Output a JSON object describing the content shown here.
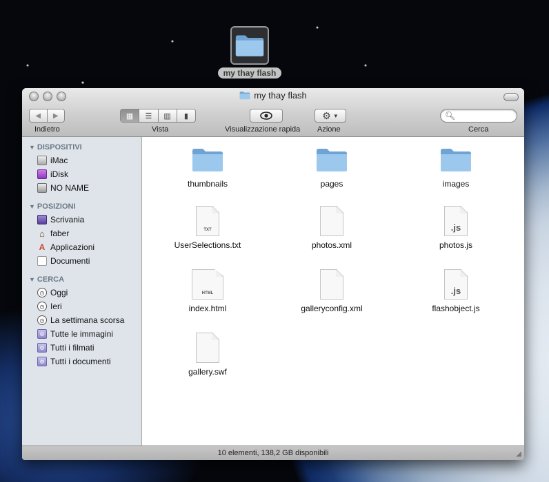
{
  "desktop": {
    "icon_label": "my thay flash"
  },
  "window": {
    "title": "my thay flash",
    "toolbar": {
      "back_label": "Indietro",
      "view_label": "Vista",
      "quicklook_label": "Visualizzazione rapida",
      "action_label": "Azione",
      "search_label": "Cerca",
      "search_placeholder": ""
    },
    "sidebar": {
      "sections": [
        {
          "title": "DISPOSITIVI",
          "items": [
            {
              "label": "iMac",
              "icon": "imac-icon"
            },
            {
              "label": "iDisk",
              "icon": "idisk-icon"
            },
            {
              "label": "NO NAME",
              "icon": "drive-icon"
            }
          ]
        },
        {
          "title": "POSIZIONI",
          "items": [
            {
              "label": "Scrivania",
              "icon": "desktop-icon"
            },
            {
              "label": "faber",
              "icon": "home-icon"
            },
            {
              "label": "Applicazioni",
              "icon": "applications-icon"
            },
            {
              "label": "Documenti",
              "icon": "documents-icon"
            }
          ]
        },
        {
          "title": "CERCA",
          "items": [
            {
              "label": "Oggi",
              "icon": "clock-icon"
            },
            {
              "label": "Ieri",
              "icon": "clock-icon"
            },
            {
              "label": "La settimana scorsa",
              "icon": "clock-icon"
            },
            {
              "label": "Tutte le immagini",
              "icon": "smart-folder-icon"
            },
            {
              "label": "Tutti i filmati",
              "icon": "smart-folder-icon"
            },
            {
              "label": "Tutti i documenti",
              "icon": "smart-folder-icon"
            }
          ]
        }
      ]
    },
    "files": [
      {
        "name": "thumbnails",
        "type": "folder"
      },
      {
        "name": "pages",
        "type": "folder"
      },
      {
        "name": "images",
        "type": "folder"
      },
      {
        "name": "UserSelections.txt",
        "type": "document",
        "tag": "TXT"
      },
      {
        "name": "photos.xml",
        "type": "document",
        "tag": ""
      },
      {
        "name": "photos.js",
        "type": "document",
        "tag": ".js"
      },
      {
        "name": "index.html",
        "type": "document",
        "tag": "HTML"
      },
      {
        "name": "galleryconfig.xml",
        "type": "document",
        "tag": ""
      },
      {
        "name": "flashobject.js",
        "type": "document",
        "tag": ".js"
      },
      {
        "name": "gallery.swf",
        "type": "document",
        "tag": ""
      }
    ],
    "status_text": "10 elementi, 138,2 GB disponibili"
  },
  "colors": {
    "folder_blue": "#8fbde6",
    "sidebar_bg": "#dee4ea",
    "sidebar_header": "#6b7785"
  }
}
